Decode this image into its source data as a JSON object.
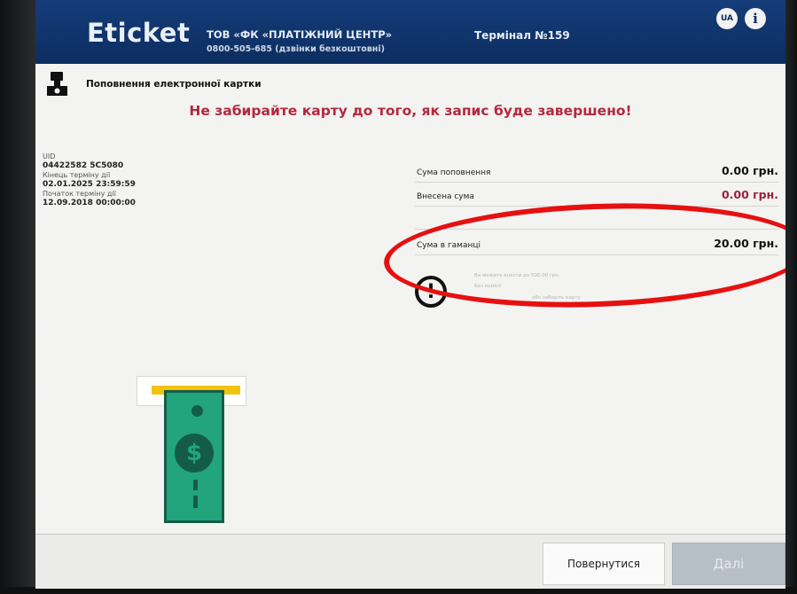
{
  "header": {
    "logo": "Eticket",
    "company": "ТОВ «ФК «ПЛАТІЖНИЙ ЦЕНТР»",
    "phone": "0800-505-685 (дзвінки безкоштовні)",
    "terminal": "Термінал №159",
    "lang_label": "UA",
    "info_label": "i"
  },
  "section": {
    "title": "Поповнення електронної картки"
  },
  "warning": "Не забирайте карту до того, як запис буде завершено!",
  "card": {
    "uid_label": "UID",
    "uid_value": "04422582 5C5080",
    "end_label": "Кінець терміну дії",
    "end_value": "02.01.2025 23:59:59",
    "start_label": "Початок терміну дії",
    "start_value": "12.09.2018 00:00:00"
  },
  "sums": {
    "topup_label": "Сума поповнення",
    "topup_value": "0.00 грн.",
    "deposited_label": "Внесена сума",
    "deposited_value": "0.00 грн.",
    "wallet_label": "Сума в гаманці",
    "wallet_value": "20.00 грн."
  },
  "hint": {
    "line1": "Ви можете внести до 500.00 грн.",
    "line2": "Без комісії",
    "line3": "або заберіть карту"
  },
  "icons": {
    "alert": "!",
    "banknote": "$"
  },
  "footer": {
    "back_label": "Повернутися",
    "next_label": "Далі"
  },
  "colors": {
    "header_bg": "#0c2d60",
    "warning": "#b4283c",
    "highlight_oval": "#e61010",
    "banknote": "#22a47c"
  }
}
